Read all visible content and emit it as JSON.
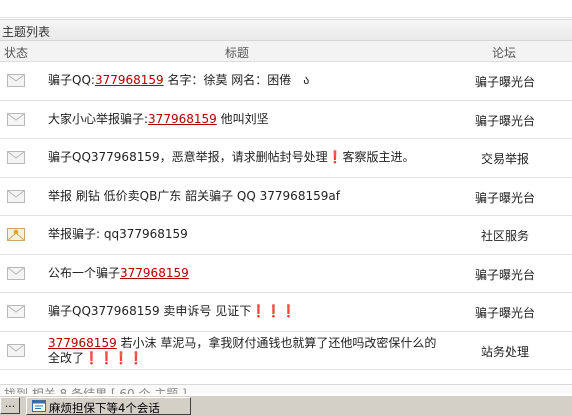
{
  "section": {
    "title": "主题列表"
  },
  "columns": {
    "status": "状态",
    "title": "标题",
    "forum": "论坛"
  },
  "rows": [
    {
      "icon": "envelope-icon",
      "title_parts": [
        "骗子QQ:",
        "377968159",
        " 名字：徐莫 网名：困倦　ა"
      ],
      "forum": "骗子曝光台"
    },
    {
      "icon": "envelope-icon",
      "title_parts": [
        "大家小心举报骗子:",
        "377968159",
        " 他叫刘坚"
      ],
      "forum": "骗子曝光台"
    },
    {
      "icon": "envelope-icon",
      "title_parts": [
        "骗子QQ377968159，恶意举报，请求删帖封号处理❗客察版主进。",
        "",
        ""
      ],
      "forum": "交易举报"
    },
    {
      "icon": "envelope-icon",
      "title_parts": [
        "举报 刷钻 低价卖QB广东 韶关骗子 QQ 377968159af",
        "",
        ""
      ],
      "forum": "骗子曝光台"
    },
    {
      "icon": "hot-envelope-icon",
      "title_parts": [
        "举报骗子: qq377968159",
        "",
        ""
      ],
      "forum": "社区服务"
    },
    {
      "icon": "envelope-icon",
      "title_parts": [
        "公布一个骗子",
        "377968159",
        ""
      ],
      "forum": "骗子曝光台"
    },
    {
      "icon": "envelope-icon",
      "title_parts": [
        "骗子QQ377968159 卖申诉号 见证下❗❗❗",
        "",
        ""
      ],
      "forum": "骗子曝光台"
    },
    {
      "icon": "envelope-icon",
      "title_parts": [
        "",
        "377968159",
        " 若小沫 草泥马，拿我财付通钱也就算了还他吗改密保什么的全改了❗❗❗❗"
      ],
      "forum": "站务处理"
    }
  ],
  "footer": {
    "partial_text": "找到 相关 8 条结果 [ 60 个 主题 ]"
  },
  "taskbar": {
    "start_stub": "...",
    "task_label": "麻烦担保下等4个会话",
    "task_icon": "chat-window-icon"
  }
}
